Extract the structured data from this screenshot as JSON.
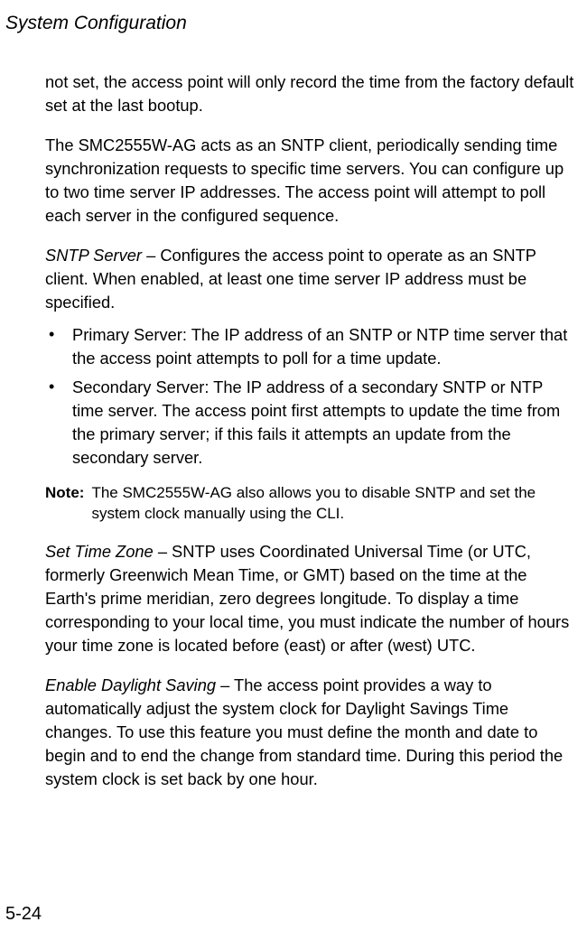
{
  "header": {
    "title": "System Configuration"
  },
  "body": {
    "p1": "not set, the access point will only record the time from the factory default set at the last bootup.",
    "p2": "The SMC2555W-AG acts as an SNTP client, periodically sending time synchronization requests to specific time servers. You can configure up to two time server IP addresses. The access point will attempt to poll each server in the configured sequence.",
    "p3_label": "SNTP Server",
    "p3_text": " – Configures the access point to operate as an SNTP client. When enabled, at least one time server IP address must be specified.",
    "bullets": [
      "Primary Server: The IP address of an SNTP or NTP time server that the access point attempts to poll for a time update.",
      "Secondary Server: The IP address of a secondary SNTP or NTP time server. The access point first attempts to update the time from the primary server; if this fails it attempts an update from the secondary server."
    ],
    "note_label": "Note:",
    "note_text": "The SMC2555W-AG also allows you to disable SNTP and set the system clock manually using the CLI.",
    "p4_label": "Set Time Zone",
    "p4_text": " – SNTP uses Coordinated Universal Time (or UTC, formerly Greenwich Mean Time, or GMT) based on the time at the Earth's prime meridian, zero degrees longitude. To display a time corresponding to your local time, you must indicate the number of hours your time zone is located before (east) or after (west) UTC.",
    "p5_label": "Enable Daylight Saving",
    "p5_text": " – The access point provides a way to automatically adjust the system clock for Daylight Savings Time changes. To use this feature you must define the month and date to begin and to end the change from standard time. During this period the system clock is set back by one hour."
  },
  "footer": {
    "page_number": "5-24"
  }
}
